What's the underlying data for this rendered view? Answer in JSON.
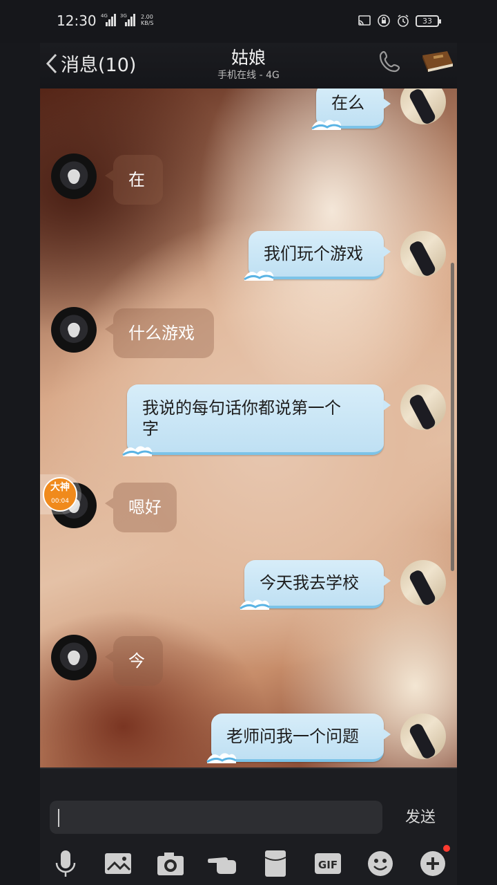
{
  "status_bar": {
    "time": "12:30",
    "net1": "4G",
    "net2": "3G",
    "speed_value": "2.00",
    "speed_unit": "KB/S",
    "battery": "33"
  },
  "header": {
    "back_label": "消息(10)",
    "title": "姑娘",
    "subtitle": "手机在线 - 4G"
  },
  "messages": [
    {
      "from": "me",
      "text": "在么"
    },
    {
      "from": "her",
      "text": "在"
    },
    {
      "from": "me",
      "text": "我们玩个游戏"
    },
    {
      "from": "her",
      "text": "什么游戏"
    },
    {
      "from": "me",
      "line1": "我说的每句话你都说第一个",
      "line2": "字"
    },
    {
      "from": "her",
      "text": "嗯好"
    },
    {
      "from": "me",
      "text": "今天我去学校"
    },
    {
      "from": "her",
      "text": "今"
    },
    {
      "from": "me",
      "text": "老师问我一个问题"
    }
  ],
  "floating_badge": {
    "logo": "大神",
    "timer": "00:04",
    "color": "#f08a1c"
  },
  "input": {
    "placeholder": "",
    "send_label": "发送"
  },
  "toolbar": {
    "icons": [
      "microphone-icon",
      "photo-album-icon",
      "camera-icon",
      "poke-icon",
      "red-packet-icon",
      "gif-icon",
      "emoji-icon",
      "plus-icon"
    ],
    "notification_dot": true
  },
  "colors": {
    "outgoing_bubble": "#cfe9f7",
    "accent_wave": "#7cc3e8",
    "badge_dot": "#ff3b30"
  }
}
